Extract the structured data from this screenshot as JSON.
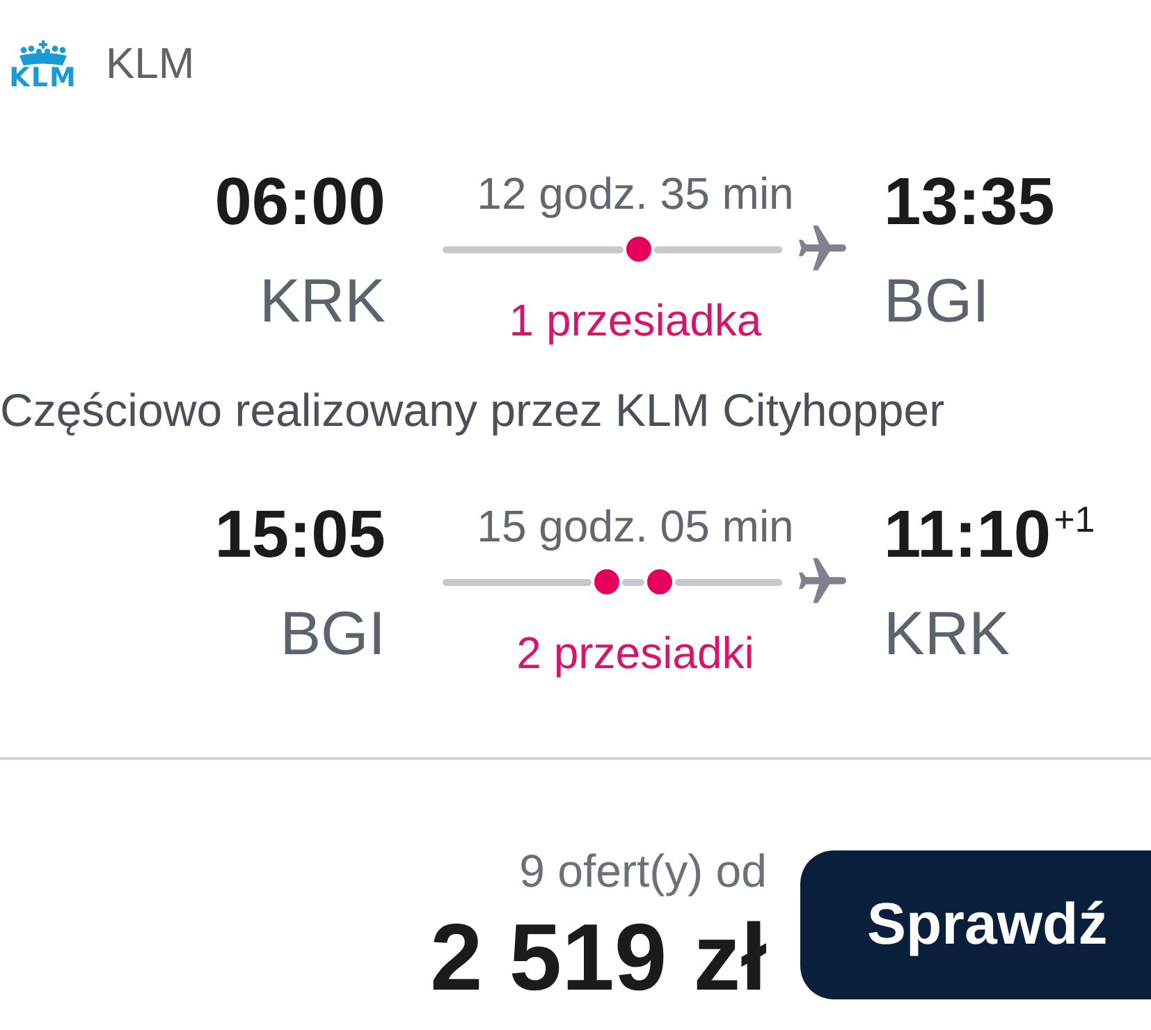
{
  "airline": {
    "logo_text": "KLM",
    "name": "KLM"
  },
  "legs": [
    {
      "departure": {
        "time": "06:00",
        "airport": "KRK"
      },
      "duration": "12 godz. 35 min",
      "kind": "one-stop",
      "stops_label": "1 przesiadka",
      "arrival": {
        "time": "13:35",
        "airport": "BGI"
      },
      "note": "Częściowo realizowany przez KLM Cityhopper"
    },
    {
      "departure": {
        "time": "15:05",
        "airport": "BGI"
      },
      "duration": "15 godz. 05 min",
      "kind": "two-stop",
      "stops_label": "2 przesiadki",
      "arrival": {
        "time": "11:10",
        "day_offset": "+1",
        "airport": "KRK"
      }
    }
  ],
  "offer": {
    "count_label": "9 ofert(y) od",
    "price": "2 519 zł",
    "button": "Sprawdź"
  }
}
